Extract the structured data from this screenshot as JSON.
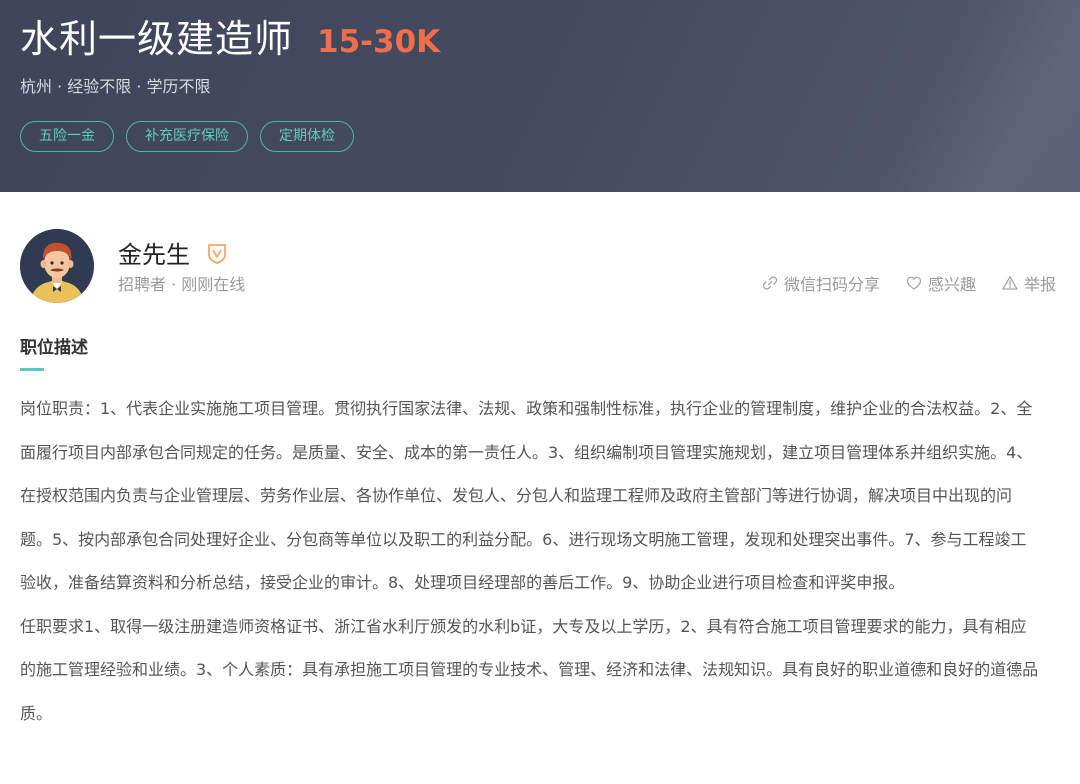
{
  "job": {
    "title": "水利一级建造师",
    "salary": "15-30K",
    "meta": "杭州 · 经验不限 · 学历不限",
    "tags": [
      "五险一金",
      "补充医疗保险",
      "定期体检"
    ]
  },
  "recruiter": {
    "name": "金先生",
    "status": "招聘者 · 刚刚在线",
    "actions": {
      "share": "微信扫码分享",
      "interest": "感兴趣",
      "report": "举报"
    }
  },
  "description": {
    "title": "职位描述",
    "text": "岗位职责：1、代表企业实施施工项目管理。贯彻执行国家法律、法规、政策和强制性标准，执行企业的管理制度，维护企业的合法权益。2、全面履行项目内部承包合同规定的任务。是质量、安全、成本的第一责任人。3、组织编制项目管理实施规划，建立项目管理体系并组织实施。4、在授权范围内负责与企业管理层、劳务作业层、各协作单位、发包人、分包人和监理工程师及政府主管部门等进行协调，解决项目中出现的问题。5、按内部承包合同处理好企业、分包商等单位以及职工的利益分配。6、进行现场文明施工管理，发现和处理突出事件。7、参与工程竣工验收，准备结算资料和分析总结，接受企业的审计。8、处理项目经理部的善后工作。9、协助企业进行项目检查和评奖申报。\n任职要求1、取得一级注册建造师资格证书、浙江省水利厅颁发的水利b证，大专及以上学历，2、具有符合施工项目管理要求的能力，具有相应的施工管理经验和业绩。3、个人素质：具有承担施工项目管理的专业技术、管理、经济和法律、法规知识。具有良好的职业道德和良好的道德品质。"
  },
  "colors": {
    "header_bg": "#454b61",
    "salary": "#f26d49",
    "tag": "#5ccdc1",
    "accent_bar": "#53cac3",
    "verify_badge": "#f2a86b"
  }
}
